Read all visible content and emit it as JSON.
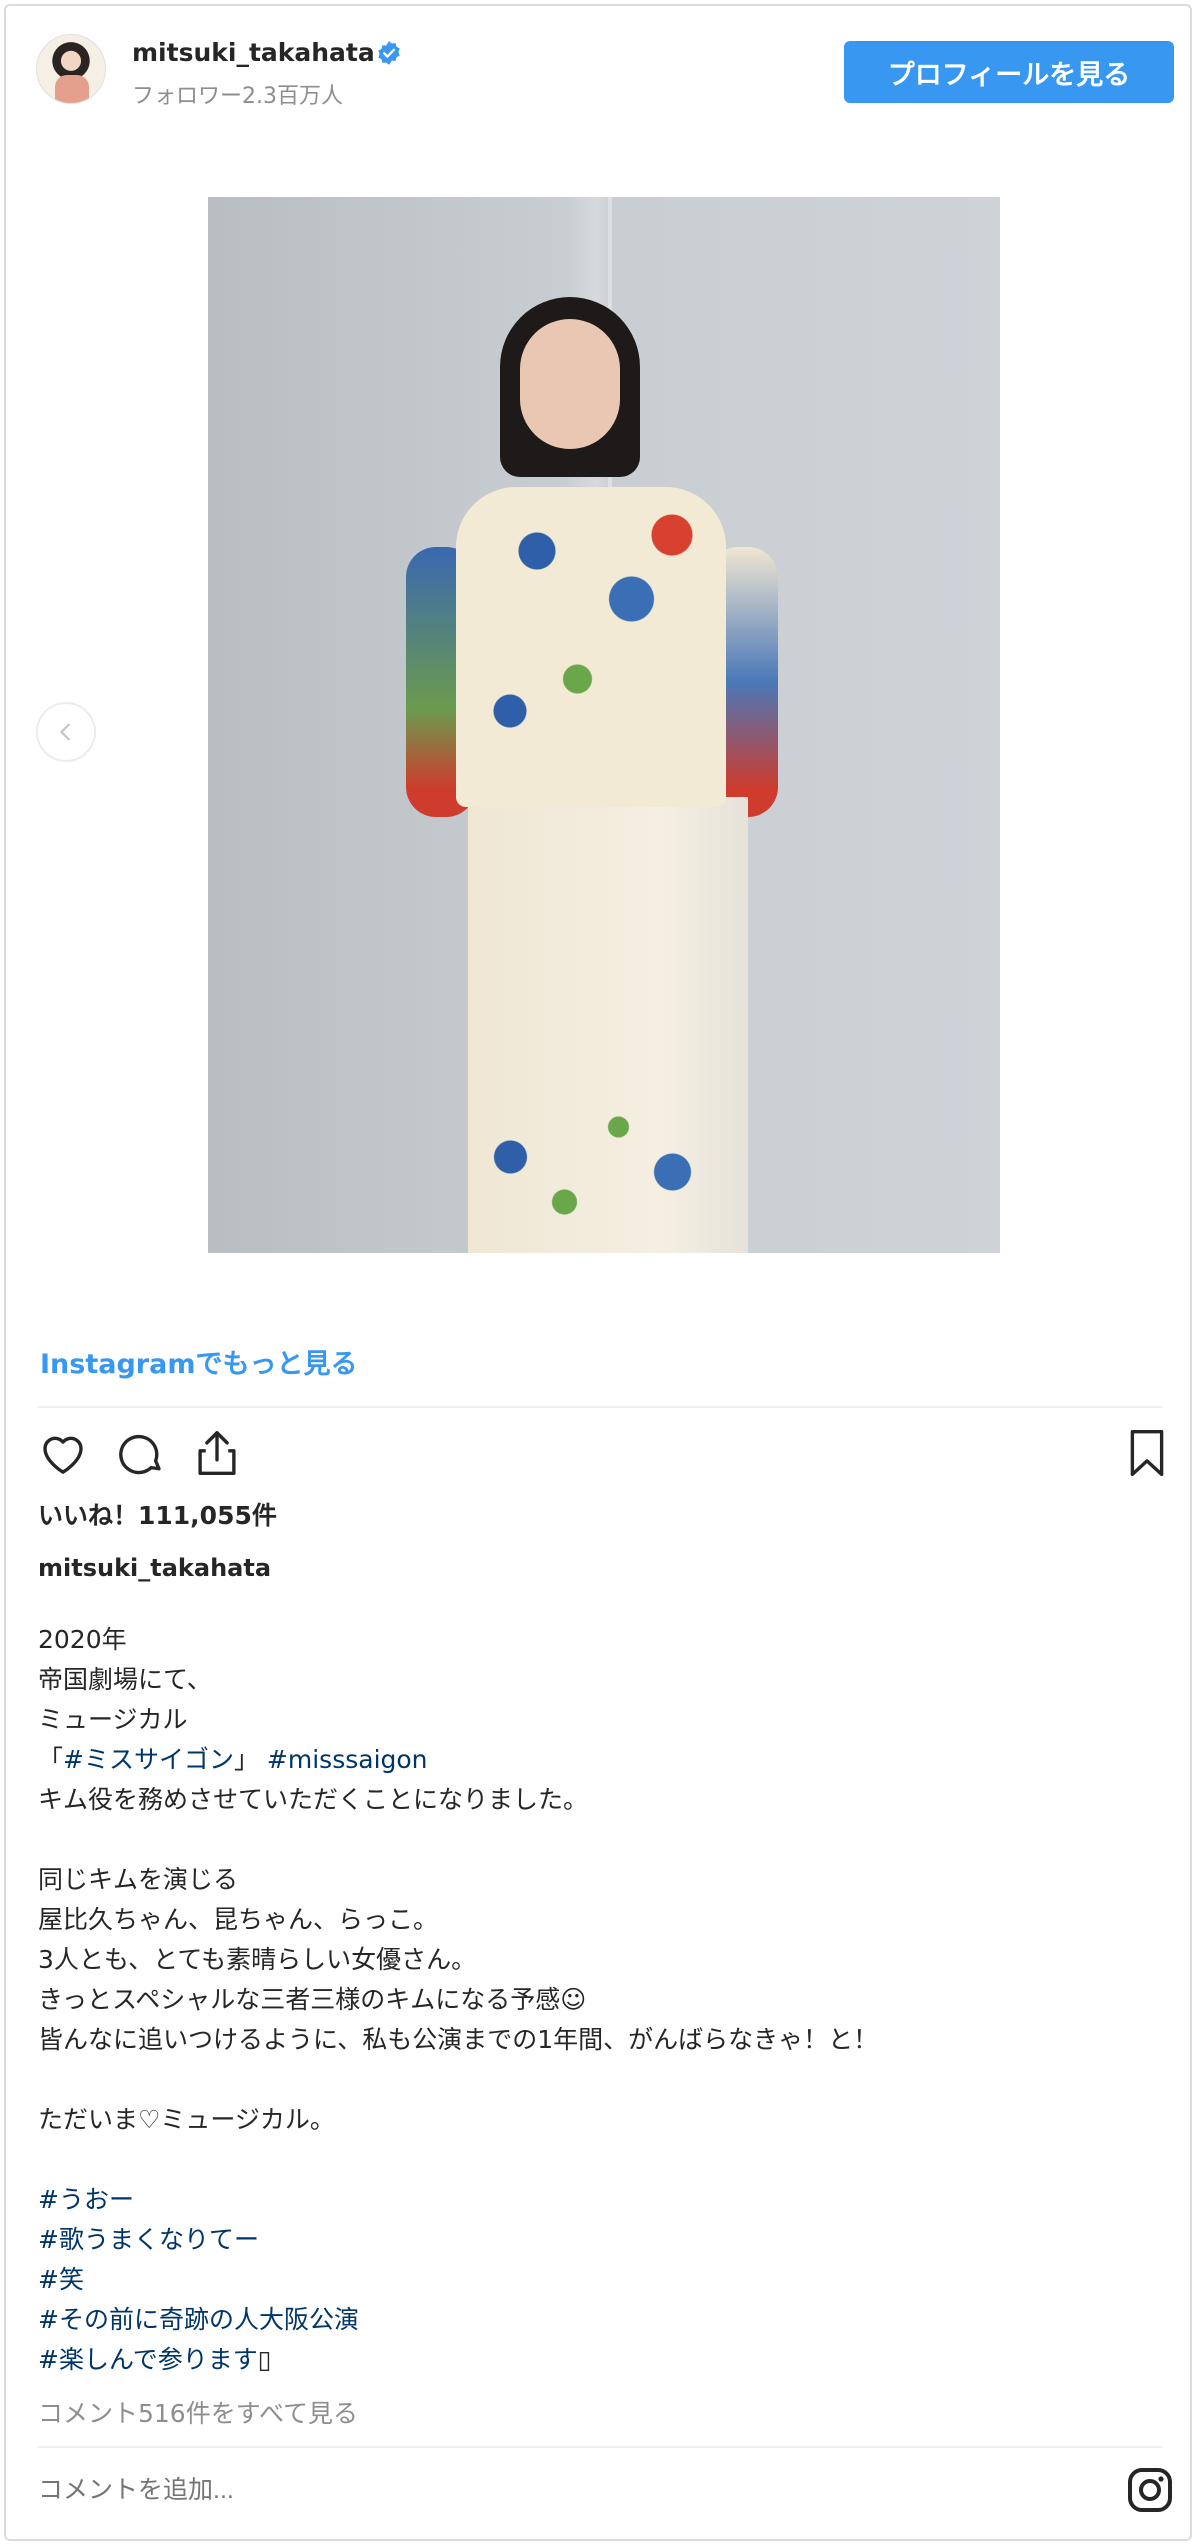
{
  "header": {
    "username": "mitsuki_takahata",
    "followers": "フォロワー2.3百万人",
    "profile_button": "プロフィールを見る"
  },
  "media": {
    "link": "Instagramでもっと見る"
  },
  "actions": {
    "likes": "いいね！111,055件"
  },
  "caption": {
    "username": "mitsuki_takahata",
    "lines": [
      [
        {
          "t": "2020年"
        }
      ],
      [
        {
          "t": "帝国劇場にて、"
        }
      ],
      [
        {
          "t": "ミュージカル"
        }
      ],
      [
        {
          "t": "「"
        },
        {
          "t": "#ミスサイゴン",
          "tag": true
        },
        {
          "t": "」 "
        },
        {
          "t": "#misssaigon",
          "tag": true
        }
      ],
      [
        {
          "t": "キム役を務めさせていただくことになりました。"
        }
      ],
      [],
      [
        {
          "t": "同じキムを演じる"
        }
      ],
      [
        {
          "t": "屋比久ちゃん、昆ちゃん、らっこ。"
        }
      ],
      [
        {
          "t": "3人とも、とても素晴らしい女優さん。"
        }
      ],
      [
        {
          "t": "きっとスペシャルな三者三様のキムになる予感☺"
        }
      ],
      [
        {
          "t": "皆んなに追いつけるように、私も公演までの1年間、がんばらなきゃ！と！"
        }
      ],
      [],
      [
        {
          "t": "ただいま♡ミュージカル。"
        }
      ],
      [],
      [
        {
          "t": "#うおー",
          "tag": true
        }
      ],
      [
        {
          "t": "#歌うまくなりてー",
          "tag": true
        }
      ],
      [
        {
          "t": "#笑",
          "tag": true
        }
      ],
      [
        {
          "t": "#その前に奇跡の人大阪公演",
          "tag": true
        }
      ],
      [
        {
          "t": "#楽しんで参ります",
          "tag": true
        },
        {
          "t": "▯"
        }
      ]
    ]
  },
  "comments": {
    "view_all": "コメント516件をすべて見る",
    "add_placeholder": "コメントを追加..."
  },
  "colors": {
    "accent": "#3897f0",
    "hashtag": "#003569",
    "muted": "#8e8e8e"
  }
}
